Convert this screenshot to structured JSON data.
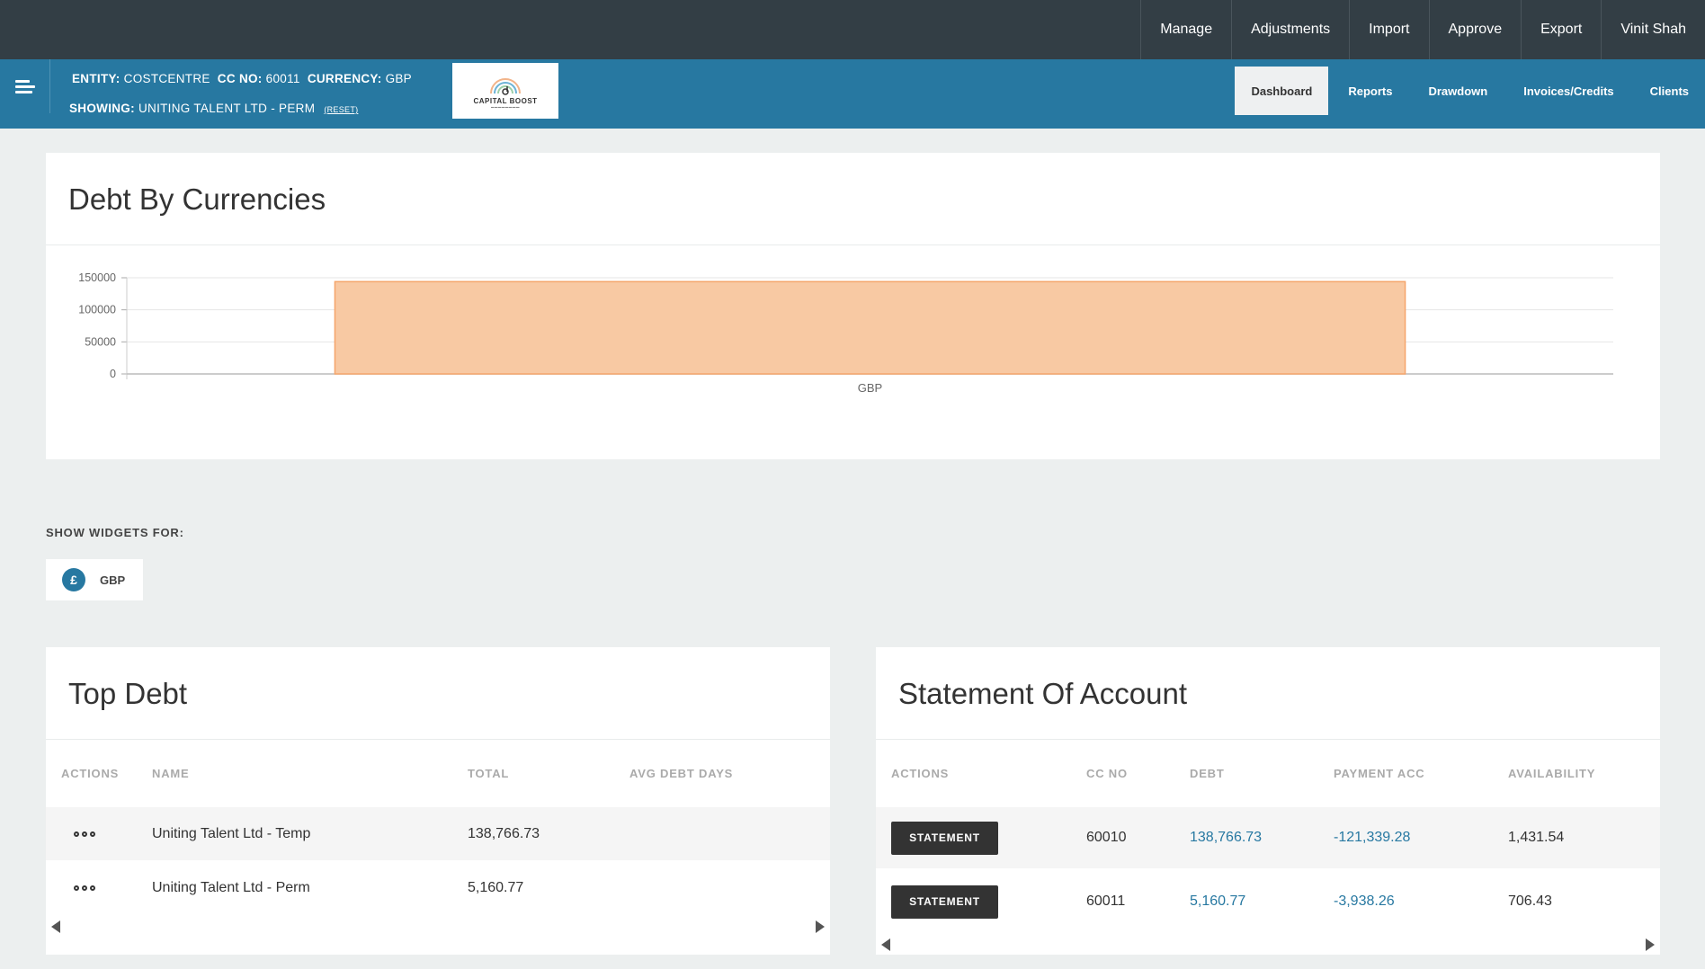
{
  "top_nav": {
    "items": [
      "Manage",
      "Adjustments",
      "Import",
      "Approve",
      "Export",
      "Vinit Shah"
    ]
  },
  "sub_bar": {
    "entity_label": "ENTITY:",
    "entity_value": "COSTCENTRE",
    "cc_label": "CC NO:",
    "cc_value": "60011",
    "currency_label": "CURRENCY:",
    "currency_value": "GBP",
    "showing_label": "SHOWING:",
    "showing_value": "UNITING TALENT LTD - PERM",
    "reset_label": "(RESET)",
    "logo_text": "CAPITAL BOOST",
    "nav": [
      {
        "label": "Dashboard",
        "active": true
      },
      {
        "label": "Reports",
        "active": false
      },
      {
        "label": "Drawdown",
        "active": false
      },
      {
        "label": "Invoices/Credits",
        "active": false
      },
      {
        "label": "Clients",
        "active": false
      }
    ]
  },
  "debt_by_currencies": {
    "title": "Debt By Currencies"
  },
  "chart_data": {
    "type": "bar",
    "categories": [
      "GBP"
    ],
    "values": [
      143927.5
    ],
    "ylim": [
      0,
      150000
    ],
    "yticks": [
      "0",
      "50000",
      "100000",
      "150000"
    ],
    "grid": true,
    "bar_fill": "#f8c9a3",
    "bar_stroke": "#f5a56b"
  },
  "widgets": {
    "label": "SHOW WIDGETS FOR:",
    "currency_symbol": "£",
    "currency": "GBP"
  },
  "top_debt": {
    "title": "Top Debt",
    "headers": [
      "ACTIONS",
      "NAME",
      "TOTAL",
      "AVG DEBT DAYS"
    ],
    "rows": [
      {
        "name": "Uniting Talent Ltd - Temp",
        "total": "138,766.73",
        "avg_debt_days": ""
      },
      {
        "name": "Uniting Talent Ltd - Perm",
        "total": "5,160.77",
        "avg_debt_days": ""
      }
    ]
  },
  "statement_of_account": {
    "title": "Statement Of Account",
    "headers": [
      "ACTIONS",
      "CC NO",
      "DEBT",
      "PAYMENT ACC",
      "AVAILABILITY"
    ],
    "button_label": "STATEMENT",
    "rows": [
      {
        "cc_no": "60010",
        "debt": "138,766.73",
        "payment_acc": "-121,339.28",
        "availability": "1,431.54"
      },
      {
        "cc_no": "60011",
        "debt": "5,160.77",
        "payment_acc": "-3,938.26",
        "availability": "706.43"
      }
    ]
  },
  "colors": {
    "top_bar": "#333e45",
    "sub_bar": "#2778a1",
    "link": "#2778a1"
  }
}
